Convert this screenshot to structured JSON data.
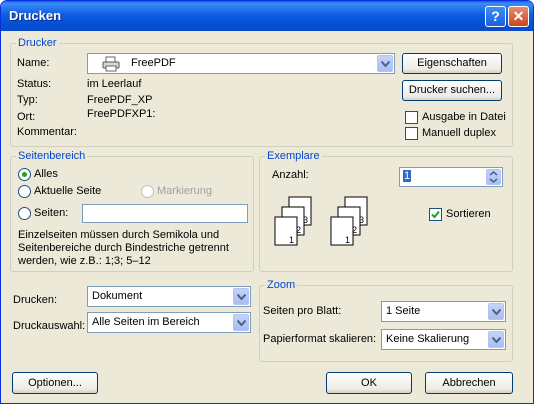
{
  "window": {
    "title": "Drucken",
    "help_label": "?",
    "close_label": "✕"
  },
  "printer": {
    "group_title": "Drucker",
    "name_label": "Name:",
    "name_value": "FreePDF",
    "status_label": "Status:",
    "status_value": "im Leerlauf",
    "type_label": "Typ:",
    "type_value": "FreePDF_XP",
    "location_label": "Ort:",
    "location_value": "FreePDFXP1:",
    "comment_label": "Kommentar:",
    "properties_button": "Eigenschaften",
    "find_printer_button": "Drucker suchen...",
    "print_to_file_label": "Ausgabe in Datei",
    "print_to_file_checked": false,
    "manual_duplex_label": "Manuell duplex",
    "manual_duplex_checked": false
  },
  "page_range": {
    "group_title": "Seitenbereich",
    "all_label": "Alles",
    "current_page_label": "Aktuelle Seite",
    "selection_label": "Markierung",
    "pages_label": "Seiten:",
    "pages_value": "",
    "selected": "all",
    "hint_line1": "Einzelseiten müssen durch Semikola und",
    "hint_line2": "Seitenbereiche durch Bindestriche getrennt",
    "hint_line3": "werden, wie z.B.: 1;3; 5–12"
  },
  "copies": {
    "group_title": "Exemplare",
    "count_label": "Anzahl:",
    "count_value": "1",
    "collate_label": "Sortieren",
    "collate_checked": true,
    "page_numbers": [
      "1",
      "2",
      "3"
    ]
  },
  "print_what": {
    "label": "Drucken:",
    "value": "Dokument"
  },
  "print_selection": {
    "label": "Druckauswahl:",
    "value": "Alle Seiten im Bereich"
  },
  "zoom": {
    "group_title": "Zoom",
    "pages_per_sheet_label": "Seiten pro Blatt:",
    "pages_per_sheet_value": "1 Seite",
    "scale_label": "Papierformat skalieren:",
    "scale_value": "Keine Skalierung"
  },
  "footer": {
    "options_button": "Optionen...",
    "ok_button": "OK",
    "cancel_button": "Abbrechen"
  },
  "colors": {
    "accent_title": "#0046d5",
    "titlebar": "#0553d8",
    "dialog_bg": "#ece9d8"
  },
  "icons": {
    "printer": "printer-icon",
    "dropdown": "chevron-down-icon",
    "spinner": "spinner-icon",
    "check": "check-icon"
  }
}
